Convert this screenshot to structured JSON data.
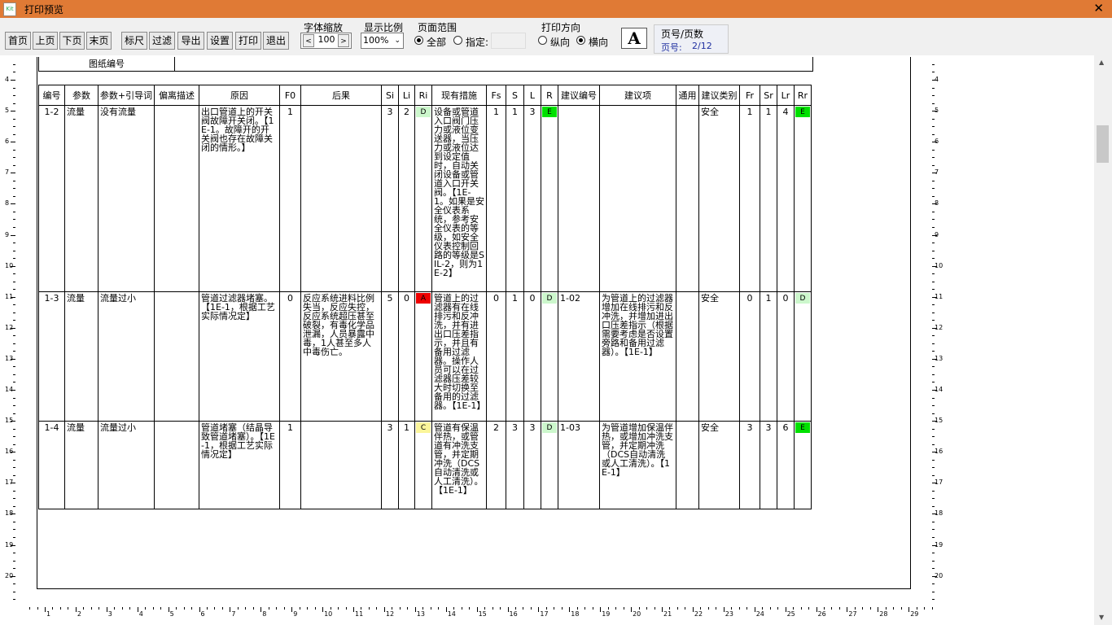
{
  "window": {
    "title": "打印预览",
    "close": "✕"
  },
  "toolbar": {
    "buttons": {
      "first": "首页",
      "prev": "上页",
      "next": "下页",
      "last": "末页",
      "ruler": "标尺",
      "filter": "过滤",
      "export": "导出",
      "settings": "设置",
      "print": "打印",
      "exit": "退出"
    },
    "font_zoom": {
      "label": "字体缩放",
      "value": "100",
      "dec": "<",
      "inc": ">"
    },
    "display_ratio": {
      "label": "显示比例",
      "value": "100%"
    },
    "page_range": {
      "label": "页面范围",
      "all": "全部",
      "specify": "指定:",
      "selected": "全部"
    },
    "orientation": {
      "label": "打印方向",
      "portrait": "纵向",
      "landscape": "横向",
      "selected": "横向"
    },
    "font_button": "A",
    "page_info": {
      "label": "页号/页数",
      "page_label": "页号:",
      "page_value": "2/12"
    }
  },
  "doc": {
    "drawing_no_label": "图纸编号",
    "headers": [
      "编号",
      "参数",
      "参数+引导词",
      "偏离描述",
      "原因",
      "F0",
      "后果",
      "Si",
      "Li",
      "Ri",
      "现有措施",
      "Fs",
      "S",
      "L",
      "R",
      "建议编号",
      "建议项",
      "通用",
      "建议类别",
      "Fr",
      "Sr",
      "Lr",
      "Rr"
    ],
    "rows": [
      {
        "no": "1-2",
        "param": "流量",
        "guide": "没有流量",
        "dev": "",
        "cause": "出口管道上的开关阀故障开关闭。【1E-1。故障开的开关阀也存在故障关闭的情形。】",
        "f0": "1",
        "conseq": "",
        "si": "3",
        "li": "2",
        "ri": "D",
        "measures": "设备或管道入口阀门压力或液位变送器，当压力或液位达到设定值时，自动关闭设备或管道入口开关阀。【1E-1。如果是安全仪表系统，参考安全仪表的等级，如安全仪表控制回路的等级是SIL-2，则为1E-2】",
        "fs": "1",
        "s": "1",
        "l": "3",
        "r": "E",
        "sug_no": "",
        "sug": "",
        "common": "",
        "category": "安全",
        "fr": "1",
        "sr": "1",
        "lr": "4",
        "rr": "E"
      },
      {
        "no": "1-3",
        "param": "流量",
        "guide": "流量过小",
        "dev": "",
        "cause": "管道过滤器堵塞。【1E-1，根据工艺实际情况定】",
        "f0": "0",
        "conseq": "反应系统进料比例失当，反应失控，反应系统超压甚至破裂，有毒化学品泄漏，人员暴露中毒，1人甚至多人中毒伤亡。",
        "si": "5",
        "li": "0",
        "ri": "A",
        "measures": "管道上的过滤器有在线排污和反冲洗，并有进出口压差指示，并且有备用过滤器。操作人员可以在过滤器压差较大时切换至备用的过滤器。【1E-1】",
        "fs": "0",
        "s": "1",
        "l": "0",
        "r": "D",
        "sug_no": "1-02",
        "sug": "为管道上的过滤器增加在线排污和反冲洗，并增加进出口压差指示（根据需要考虑是否设置旁路和备用过滤器）。【1E-1】",
        "common": "",
        "category": "安全",
        "fr": "0",
        "sr": "1",
        "lr": "0",
        "rr": "D"
      },
      {
        "no": "1-4",
        "param": "流量",
        "guide": "流量过小",
        "dev": "",
        "cause": "管道堵塞（结晶导致管道堵塞）。【1E-1，根据工艺实际情况定】",
        "f0": "1",
        "conseq": "",
        "si": "3",
        "li": "1",
        "ri": "C",
        "measures": "管道有保温伴热，或管道有冲洗支管，并定期冲洗（DCS自动清洗或人工清洗）。【1E-1】",
        "fs": "2",
        "s": "3",
        "l": "3",
        "r": "D",
        "sug_no": "1-03",
        "sug": "为管道增加保温伴热，或增加冲洗支管，并定期冲洗（DCS自动清洗或人工清洗）。【1E-1】",
        "common": "",
        "category": "安全",
        "fr": "3",
        "sr": "3",
        "lr": "6",
        "rr": "E"
      }
    ]
  },
  "colors": {
    "green": "#00e000",
    "light_green": "#ccf7cc",
    "red": "#ee0000",
    "yellow": "#fbf59a",
    "titlebar": "#e07a35"
  },
  "ruler": {
    "v_labels": [
      "4",
      "5",
      "6",
      "7",
      "8",
      "9",
      "10",
      "11",
      "12",
      "13",
      "14",
      "15",
      "16",
      "17",
      "18",
      "19",
      "20"
    ],
    "h_labels": [
      "1",
      "2",
      "3",
      "4",
      "5",
      "6",
      "7",
      "8",
      "9",
      "10",
      "11",
      "12",
      "13",
      "14",
      "15",
      "16",
      "17",
      "18",
      "19",
      "20",
      "21",
      "22",
      "23",
      "24",
      "25",
      "26",
      "27",
      "28",
      "29"
    ]
  }
}
